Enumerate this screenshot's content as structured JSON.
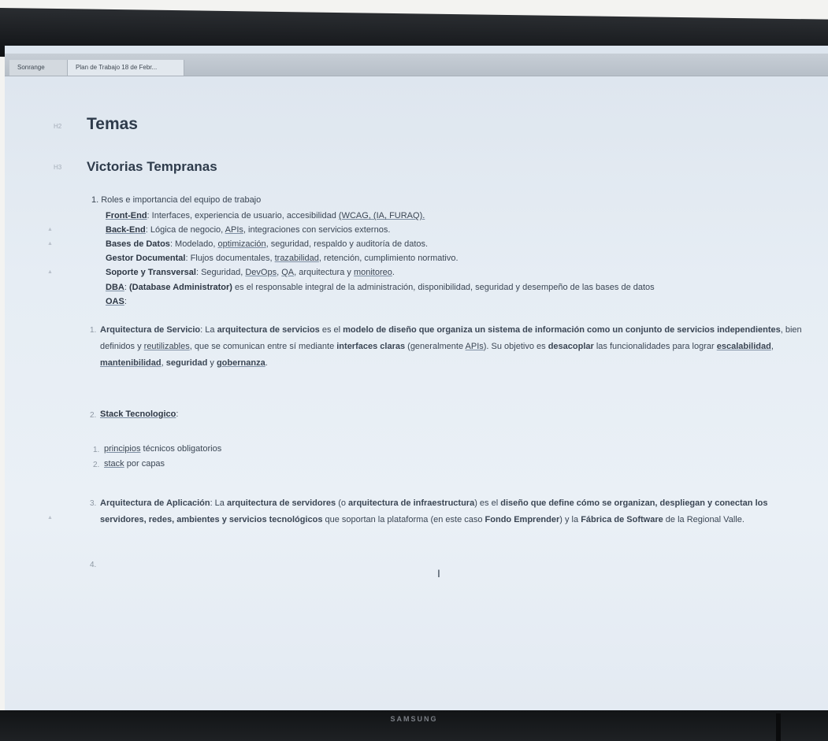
{
  "tabs": [
    "Sonrange",
    "Plan de Trabajo 18 de Febr..."
  ],
  "monitor_brand": "SAMSUNG",
  "headings": {
    "h1_gutter": "H2",
    "h1": "Temas",
    "h2_gutter": "H3",
    "h2": "Victorias Tempranas"
  },
  "roles": {
    "title": "1. Roles e importancia del equipo de trabajo",
    "frontend_label": "Front-End",
    "frontend_text_a": ": Interfaces, experiencia de usuario, accesibilidad ",
    "frontend_links": "(WCAG, (IA, FURAQ).",
    "backend_label": "Back-End",
    "backend_text_a": ": Lógica de negocio, ",
    "backend_link": "APIs",
    "backend_text_b": ", integraciones con servicios externos.",
    "db_label": "Bases de Datos",
    "db_text_a": ": Modelado, ",
    "db_link": "optimización",
    "db_text_b": ", seguridad, respaldo y auditoría de datos.",
    "docs_label": "Gestor Documental",
    "docs_text_a": ": Flujos documentales, ",
    "docs_link": "trazabilidad",
    "docs_text_b": ", retención, cumplimiento normativo.",
    "support_label": "Soporte y Transversal",
    "support_text_a": ": Seguridad, ",
    "support_link1": "DevOps",
    "support_text_b": ", ",
    "support_link2": "QA",
    "support_text_c": ", arquitectura y ",
    "support_link3": "monitoreo",
    "support_text_d": ".",
    "dba_label": "DBA",
    "dba_text_a": ": ",
    "dba_bold": "(Database Administrator)",
    "dba_text_b": " es el responsable integral de la administración, disponibilidad, seguridad y desempeño de las bases de datos",
    "oas_label": "OAS",
    "oas_text": ":"
  },
  "service": {
    "num": "1.",
    "title": "Arquitectura de Servicio",
    "t1": ": La ",
    "b1": "arquitectura de servicios",
    "t2": " es el ",
    "b2": "modelo de diseño que organiza un sistema de información como un conjunto de servicios independientes",
    "t3": ", bien definidos y ",
    "l1": "reutilizables",
    "t4": ", que se comunican entre sí mediante ",
    "b3": "interfaces claras",
    "t5": " (generalmente ",
    "l2": "APIs",
    "t6": "). Su objetivo es ",
    "b4": "desacoplar",
    "t7": " las funcionalidades para lograr ",
    "b5": "escalabilidad",
    "t8": ", ",
    "b6": "mantenibilidad",
    "t9": ", ",
    "b7": "seguridad",
    "t10": " y ",
    "b8": "gobernanza",
    "t11": "."
  },
  "stack": {
    "num": "2.",
    "title": "Stack Tecnologico",
    "colon": ":",
    "item1_num": "1.",
    "item1_link": "principios",
    "item1_text": " técnicos obligatorios",
    "item2_num": "2.",
    "item2_link": "stack",
    "item2_text": " por capas"
  },
  "app": {
    "num": "3.",
    "title": "Arquitectura de Aplicación",
    "t1": ": La ",
    "b1": "arquitectura de servidores",
    "t2": " (o ",
    "b2": "arquitectura de infraestructura",
    "t3": ") es el ",
    "b3": "diseño que define cómo se organizan, despliegan y conectan los servidores, redes, ambientes y servicios tecnológicos",
    "t4": " que soportan la plataforma (en este caso ",
    "b4": "Fondo Emprender",
    "t5": ") y la ",
    "b5": "Fábrica de Software",
    "t6": " de la Regional Valle."
  },
  "item4_num": "4.",
  "cursor_glyph": "I",
  "colors": {
    "screen_bg": "#e6edf4",
    "text": "#3b4654",
    "heading": "#2e3b4b"
  }
}
